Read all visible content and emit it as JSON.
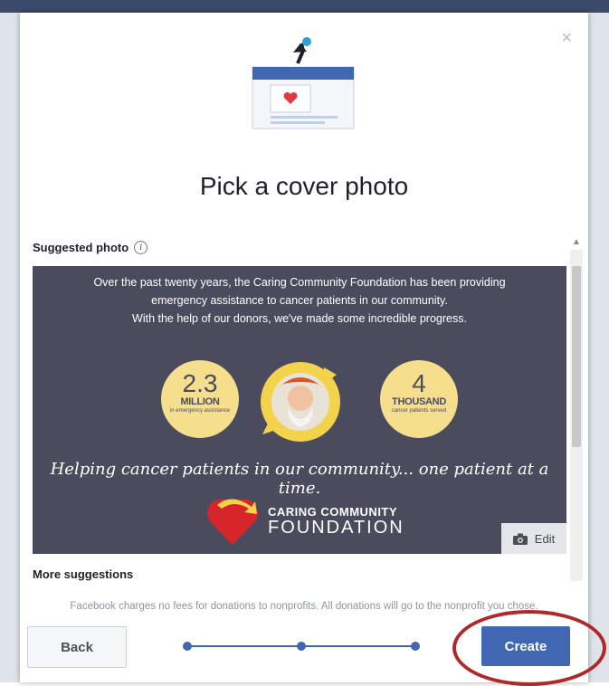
{
  "dialog": {
    "title": "Pick a cover photo",
    "close_icon": "×"
  },
  "suggested": {
    "label": "Suggested photo",
    "info_icon": "i"
  },
  "photo": {
    "line1": "Over the past twenty years, the Caring Community Foundation has been providing",
    "line2": "emergency assistance to cancer patients in our community.",
    "line3": "With the help of our donors,  we've made some incredible progress.",
    "stat1": {
      "number": "2.3",
      "unit": "MILLION",
      "sub": "in emergency assistance"
    },
    "stat2": {
      "number": "4",
      "unit": "THOUSAND",
      "sub": "cancer patients served"
    },
    "tagline": "Helping cancer patients in our community... one patient at a time.",
    "logo_line1": "CARING COMMUNITY",
    "logo_line2": "FOUNDATION",
    "edit_label": "Edit"
  },
  "more_suggestions_label": "More suggestions",
  "footer": {
    "note": "Facebook charges no fees for donations to nonprofits. All donations will go to the nonprofit you chose.",
    "back_label": "Back",
    "create_label": "Create",
    "steps_total": 3,
    "step_current": 3
  },
  "colors": {
    "accent": "#4267b2",
    "photo_bg": "#4b4b5e",
    "stat_circle": "#f5df8d",
    "highlight": "#b0282a"
  }
}
